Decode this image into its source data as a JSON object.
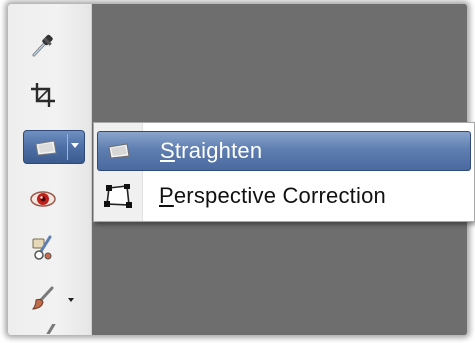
{
  "toolbar": {
    "tools": [
      {
        "name": "eyedropper",
        "icon": "eyedropper-icon"
      },
      {
        "name": "crop",
        "icon": "crop-icon"
      },
      {
        "name": "straighten",
        "icon": "straighten-icon",
        "active": true,
        "has_dropdown": true
      },
      {
        "name": "red-eye",
        "icon": "red-eye-icon"
      },
      {
        "name": "clone",
        "icon": "clone-icon"
      },
      {
        "name": "brush",
        "icon": "brush-icon",
        "has_dropdown": true
      }
    ]
  },
  "menu": {
    "items": [
      {
        "mnemonic": "S",
        "rest": "traighten",
        "icon": "straighten-icon",
        "selected": true
      },
      {
        "mnemonic": "P",
        "rest": "erspective Correction",
        "icon": "perspective-correction-icon",
        "selected": false
      }
    ]
  },
  "colors": {
    "selection": "#5f7fb1",
    "canvas": "#6e6e6e",
    "toolbar": "#eeeeee"
  }
}
